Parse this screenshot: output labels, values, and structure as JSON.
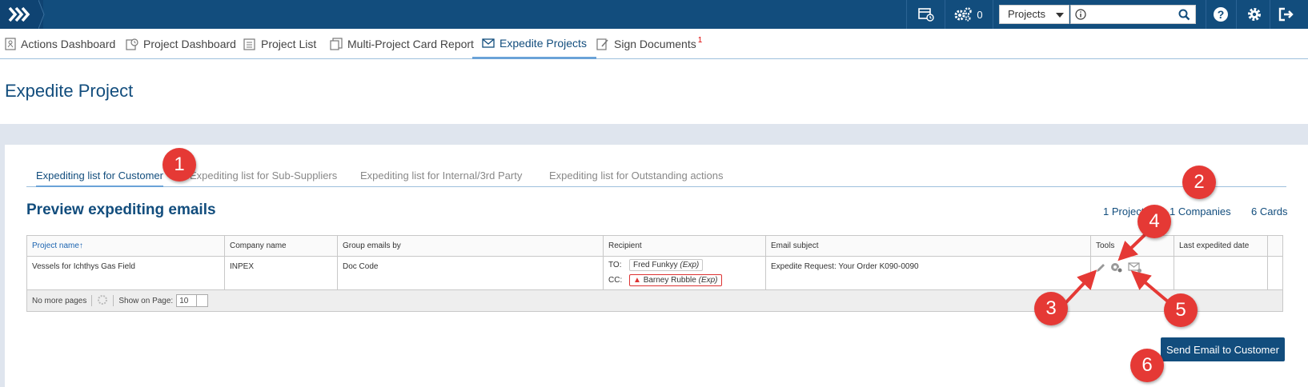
{
  "topbar": {
    "notification_count": "0",
    "search_scope": "Projects",
    "search_placeholder": "",
    "icons": [
      "logo-chevrons-icon",
      "calendar-clock-icon",
      "gears-icon",
      "info-icon",
      "search-icon",
      "help-icon",
      "settings-icon",
      "logout-icon"
    ]
  },
  "nav": {
    "items": [
      {
        "label": "Actions Dashboard",
        "icon": "actions-dashboard-icon"
      },
      {
        "label": "Project Dashboard",
        "icon": "project-dashboard-icon"
      },
      {
        "label": "Project List",
        "icon": "project-list-icon"
      },
      {
        "label": "Multi-Project Card Report",
        "icon": "multi-project-report-icon"
      },
      {
        "label": "Expedite Projects",
        "icon": "envelope-icon",
        "active": true
      },
      {
        "label": "Sign Documents",
        "icon": "sign-documents-icon",
        "badge": "1"
      }
    ]
  },
  "page": {
    "title": "Expedite Project"
  },
  "subtabs": [
    {
      "label": "Expediting list for Customer",
      "active": true
    },
    {
      "label": "Expediting list for Sub-Suppliers"
    },
    {
      "label": "Expediting list for Internal/3rd Party"
    },
    {
      "label": "Expediting list for Outstanding actions"
    }
  ],
  "preview": {
    "title": "Preview expediting emails",
    "stats": {
      "projects": "1 Projects",
      "companies": "1 Companies",
      "cards": "6 Cards"
    }
  },
  "table": {
    "headers": {
      "project_name": "Project name",
      "company_name": "Company name",
      "group_by": "Group emails by",
      "recipient": "Recipient",
      "email_subject": "Email subject",
      "tools": "Tools",
      "last_expedited": "Last expedited date"
    },
    "rows": [
      {
        "project_name": "Vessels for Ichthys Gas Field",
        "company_name": "INPEX",
        "group_by": "Doc Code",
        "to_label": "TO:",
        "to_name": "Fred Funkyy",
        "to_role": "(Exp)",
        "cc_label": "CC:",
        "cc_name": "Barney Rubble",
        "cc_role": "(Exp)",
        "email_subject": "Expedite Request: Your Order K090-0090",
        "last_expedited": ""
      }
    ],
    "pager": {
      "status": "No more pages",
      "show_label": "Show on Page:",
      "page_size": "10"
    }
  },
  "actions": {
    "send_label": "Send Email to Customer"
  },
  "annotations": [
    "1",
    "2",
    "3",
    "4",
    "5",
    "6"
  ],
  "colors": {
    "brand": "#124d7d",
    "annotation": "#e53935"
  }
}
